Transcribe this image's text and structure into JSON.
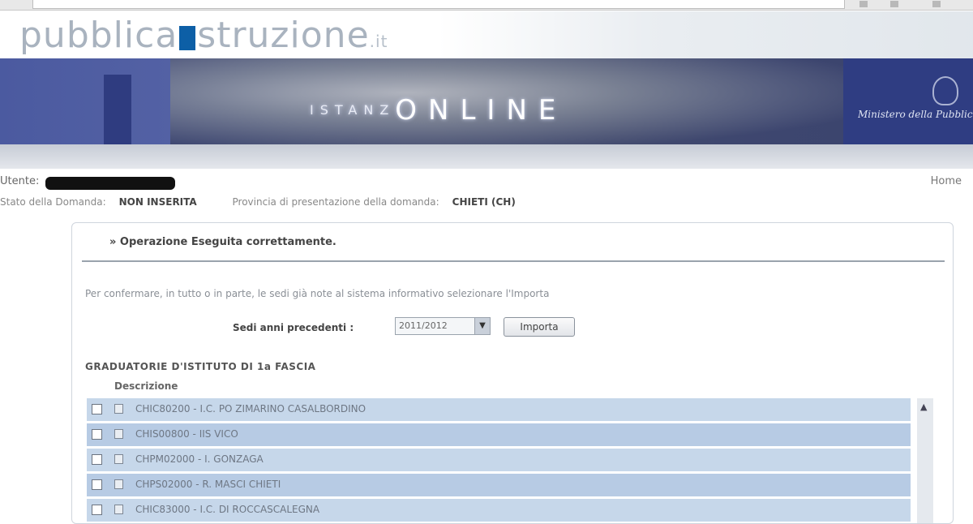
{
  "site": {
    "title_part1": "pubblica",
    "title_part2": "struzi",
    "title_part3": "one",
    "tld": ".it"
  },
  "banner": {
    "logo_small": "ISTANZ",
    "logo_large": "ONLINE",
    "ministry": "Ministero della Pubblica Istruzione"
  },
  "user": {
    "label": "Utente:",
    "home_link": "Home"
  },
  "status": {
    "state_label": "Stato della Domanda:",
    "state_value": "NON INSERITA",
    "province_label": "Provincia di presentazione della domanda:",
    "province_value": "CHIETI (CH)"
  },
  "form": {
    "title": "» Operazione Eseguita correttamente.",
    "instructions": "Per confermare, in tutto o in parte, le sedi già note al sistema informativo selezionare l'Importa",
    "select_label": "Sedi anni precedenti :",
    "select_value": "2011/2012",
    "import_button": "Importa",
    "section_title": "GRADUATORIE D'ISTITUTO DI 1a FASCIA",
    "column_header": "Descrizione",
    "rows": [
      "CHIC80200 - I.C. PO ZIMARINO CASALBORDINO",
      "CHIS00800 - IIS VICO",
      "CHPM02000 - I. GONZAGA",
      "CHPS02000 - R. MASCI CHIETI",
      "CHIC83000 - I.C. DI ROCCASCALEGNA"
    ]
  }
}
